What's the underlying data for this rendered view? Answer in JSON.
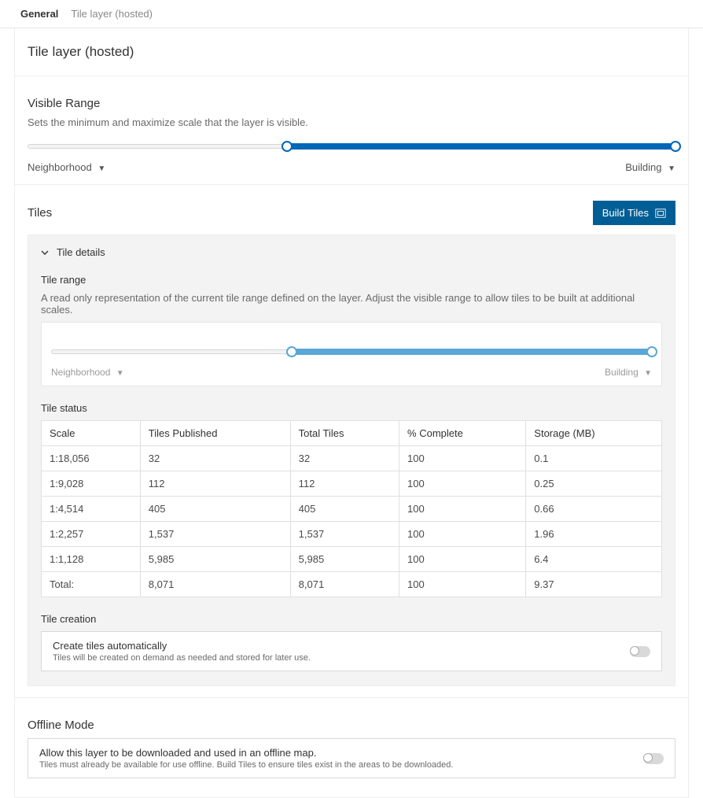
{
  "tabs": {
    "general": "General",
    "tile_layer": "Tile layer (hosted)"
  },
  "page_title": "Tile layer (hosted)",
  "visible_range": {
    "heading": "Visible Range",
    "hint": "Sets the minimum and maximize scale that the layer is visible.",
    "min_label": "Neighborhood",
    "max_label": "Building"
  },
  "tiles": {
    "heading": "Tiles",
    "build_button": "Build Tiles",
    "details_label": "Tile details",
    "tile_range": {
      "heading": "Tile range",
      "hint": "A read only representation of the current tile range defined on the layer. Adjust the visible range to allow tiles to be built at additional scales.",
      "min_label": "Neighborhood",
      "max_label": "Building"
    },
    "tile_status": {
      "heading": "Tile status",
      "columns": [
        "Scale",
        "Tiles Published",
        "Total Tiles",
        "% Complete",
        "Storage (MB)"
      ],
      "rows": [
        [
          "1:18,056",
          "32",
          "32",
          "100",
          "0.1"
        ],
        [
          "1:9,028",
          "112",
          "112",
          "100",
          "0.25"
        ],
        [
          "1:4,514",
          "405",
          "405",
          "100",
          "0.66"
        ],
        [
          "1:2,257",
          "1,537",
          "1,537",
          "100",
          "1.96"
        ],
        [
          "1:1,128",
          "5,985",
          "5,985",
          "100",
          "6.4"
        ],
        [
          "Total:",
          "8,071",
          "8,071",
          "100",
          "9.37"
        ]
      ]
    },
    "tile_creation": {
      "heading": "Tile creation",
      "option_title": "Create tiles automatically",
      "option_desc": "Tiles will be created on demand as needed and stored for later use."
    }
  },
  "offline": {
    "heading": "Offline Mode",
    "option_title": "Allow this layer to be downloaded and used in an offline map.",
    "option_desc": "Tiles must already be available for use offline. Build Tiles to ensure tiles exist in the areas to be downloaded."
  }
}
